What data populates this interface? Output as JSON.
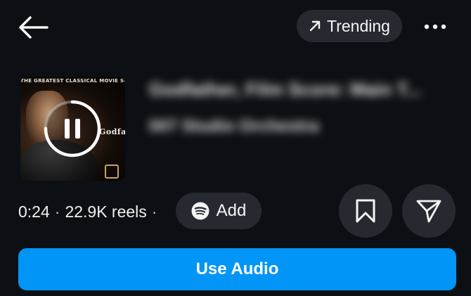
{
  "header": {
    "back_icon": "arrow-left-icon",
    "trending_label": "Trending",
    "trending_icon": "arrow-up-right-icon",
    "more_icon": "more-horizontal-icon"
  },
  "track": {
    "cover_text": "THE GREATEST CLASSICAL MOVIE SOUNDTRACKS",
    "cover_logo_text": "Godfather",
    "title": "Godfather, Film Score: Main T...",
    "artist": "007 Studio Orchestra",
    "playback_state": "playing",
    "progress": 0.75
  },
  "meta": {
    "duration": "0:24",
    "separator": "·",
    "reels_count": "22.9K reels",
    "separator2": "·"
  },
  "actions": {
    "add_label": "Add",
    "add_icon": "spotify-icon",
    "save_icon": "bookmark-icon",
    "share_icon": "send-icon",
    "use_audio_label": "Use Audio"
  },
  "colors": {
    "background": "#0c1014",
    "chip": "#262a30",
    "primary_button": "#0095f6",
    "text": "#f5f5f5"
  }
}
